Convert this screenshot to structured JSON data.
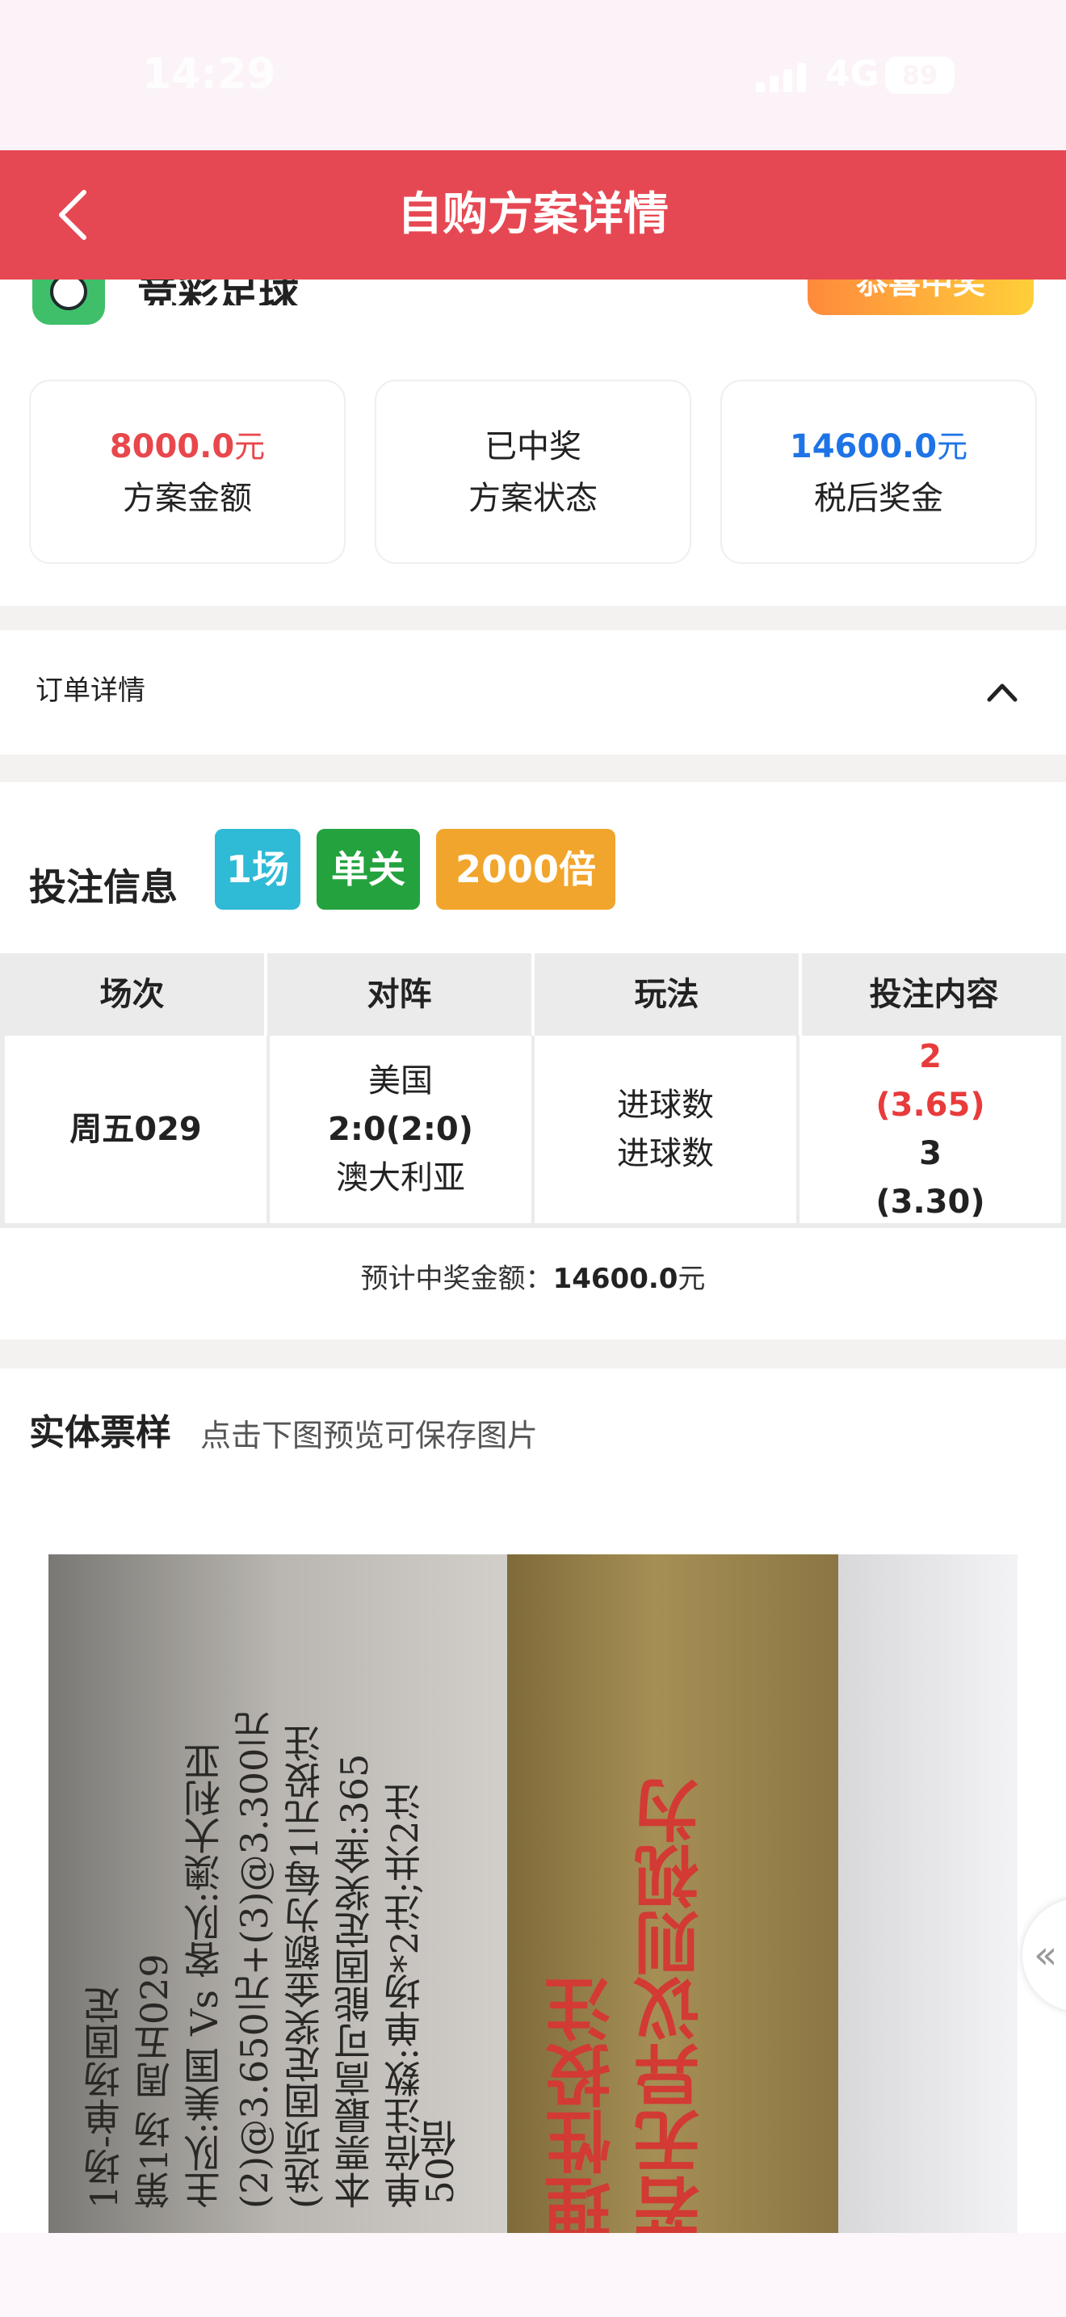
{
  "status_bar": {
    "time": "14:29",
    "network": "4G",
    "battery": "89"
  },
  "nav": {
    "title": "自购方案详情"
  },
  "lottery": {
    "name": "竞彩足球",
    "badge": "恭喜中奖"
  },
  "summary": {
    "amount": {
      "value": "8000.0",
      "unit": "元",
      "label": "方案金额",
      "color": "#e8474c"
    },
    "status": {
      "value": "已中奖",
      "label": "方案状态"
    },
    "prize": {
      "value": "14600.0",
      "unit": "元",
      "label": "税后奖金",
      "color": "#1e74e6"
    }
  },
  "order": {
    "label": "订单详情"
  },
  "bet": {
    "title": "投注信息",
    "tags": [
      {
        "label": "1场",
        "color": "#2fbad6"
      },
      {
        "label": "单关",
        "color": "#23a23d"
      },
      {
        "label": "2000倍",
        "color": "#f1a52c"
      }
    ],
    "headers": [
      "场次",
      "对阵",
      "玩法",
      "投注内容"
    ],
    "row": {
      "match_no": "周五029",
      "home": "美国",
      "score": "2:0(2:0)",
      "away": "澳大利亚",
      "play_1": "进球数",
      "play_2": "进球数",
      "pick_1": "2",
      "odds_1": "(3.65)",
      "pick_2": "3",
      "odds_2": "(3.30)"
    },
    "estimate_label": "预计中奖金额：",
    "estimate_value": "14600.0",
    "estimate_unit": "元"
  },
  "ticket": {
    "title": "实体票样",
    "hint": "点击下图预览可保存图片",
    "photo_lines_paper": [
      "1场-单场固定",
      "第1场 周五029",
      "主队:美国 Vs 客队:澳大利亚",
      "(2)@3.650元+(3)@3.300元",
      "(选项固定奖金额为每1元投注",
      "本票最高可能固定奖金:365",
      "单倍注数:单场*2注;共2注"
    ],
    "photo_multiplier": "50倍",
    "photo_lines_brass": [
      "理性投注",
      "若无异议则视为"
    ]
  },
  "side_button": {
    "label": "«"
  }
}
